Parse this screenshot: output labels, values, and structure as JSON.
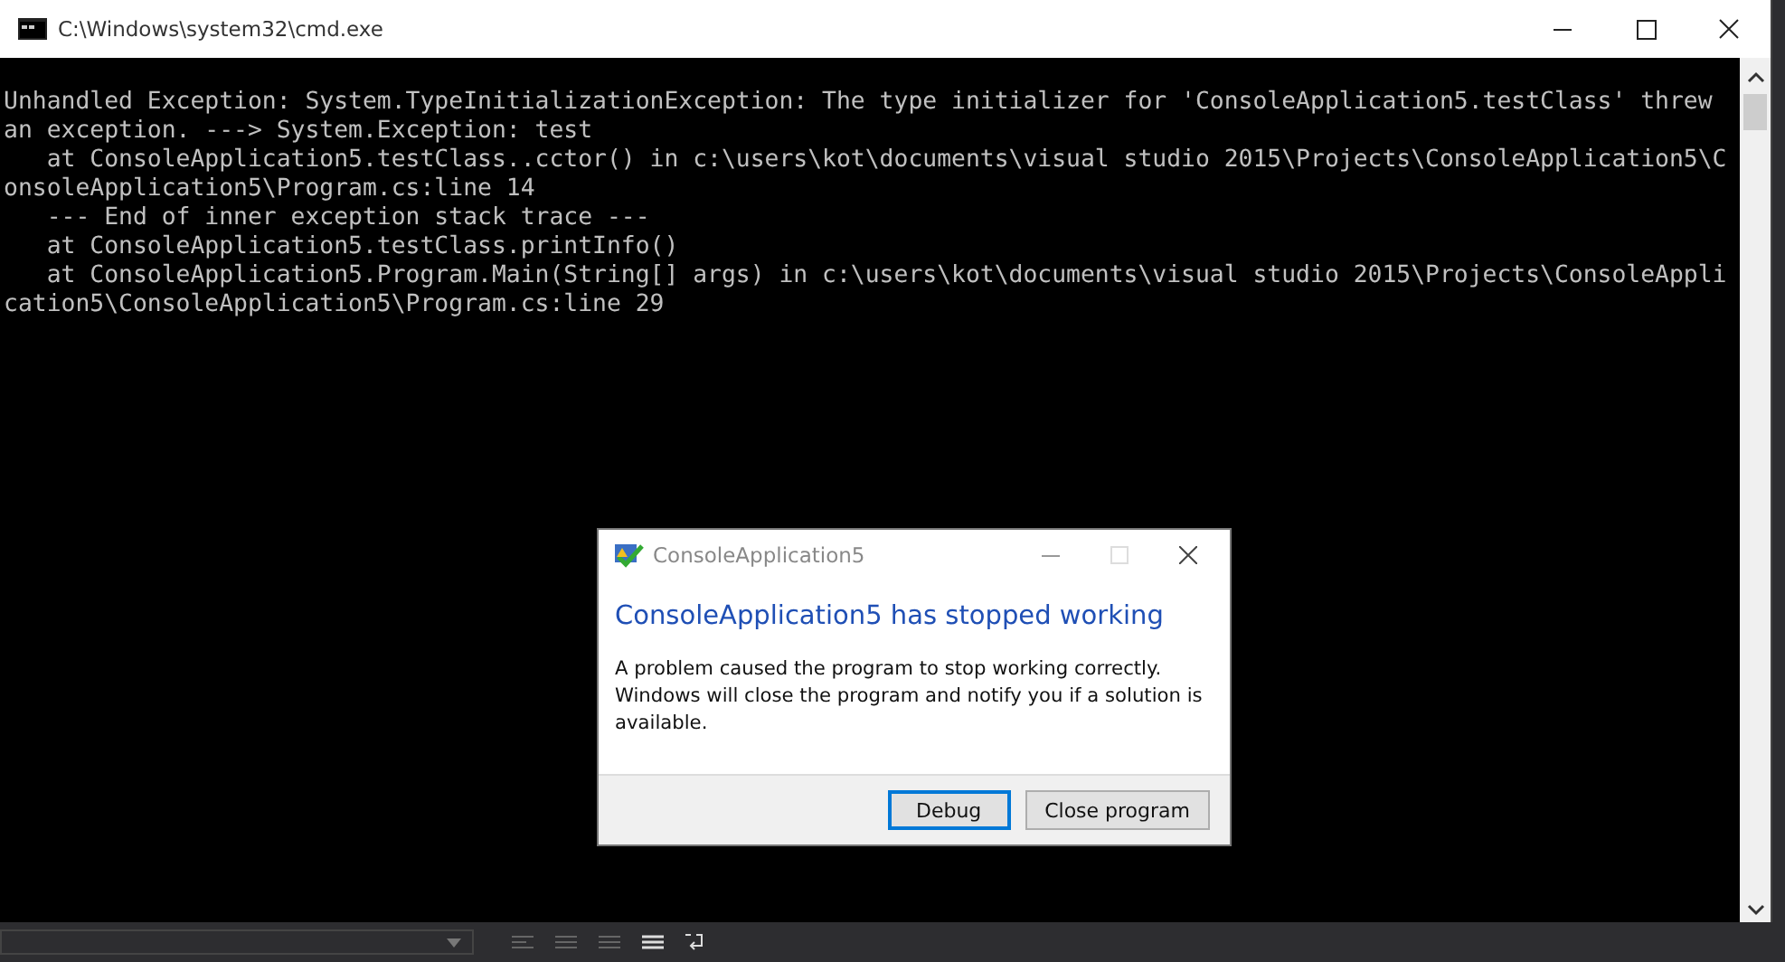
{
  "window": {
    "title": "C:\\Windows\\system32\\cmd.exe"
  },
  "console": {
    "lines": [
      "Unhandled Exception: System.TypeInitializationException: The type initializer for 'ConsoleApplication5.testClass' threw",
      "an exception. ---> System.Exception: test",
      "   at ConsoleApplication5.testClass..cctor() in c:\\users\\kot\\documents\\visual studio 2015\\Projects\\ConsoleApplication5\\C",
      "onsoleApplication5\\Program.cs:line 14",
      "   --- End of inner exception stack trace ---",
      "   at ConsoleApplication5.testClass.printInfo()",
      "   at ConsoleApplication5.Program.Main(String[] args) in c:\\users\\kot\\documents\\visual studio 2015\\Projects\\ConsoleAppli",
      "cation5\\ConsoleApplication5\\Program.cs:line 29"
    ]
  },
  "dialog": {
    "title": "ConsoleApplication5",
    "heading": "ConsoleApplication5 has stopped working",
    "message": "A problem caused the program to stop working correctly. Windows will close the program and notify you if a solution is available.",
    "buttons": [
      {
        "label": "Debug",
        "selected": true
      },
      {
        "label": "Close program",
        "selected": false
      }
    ]
  }
}
